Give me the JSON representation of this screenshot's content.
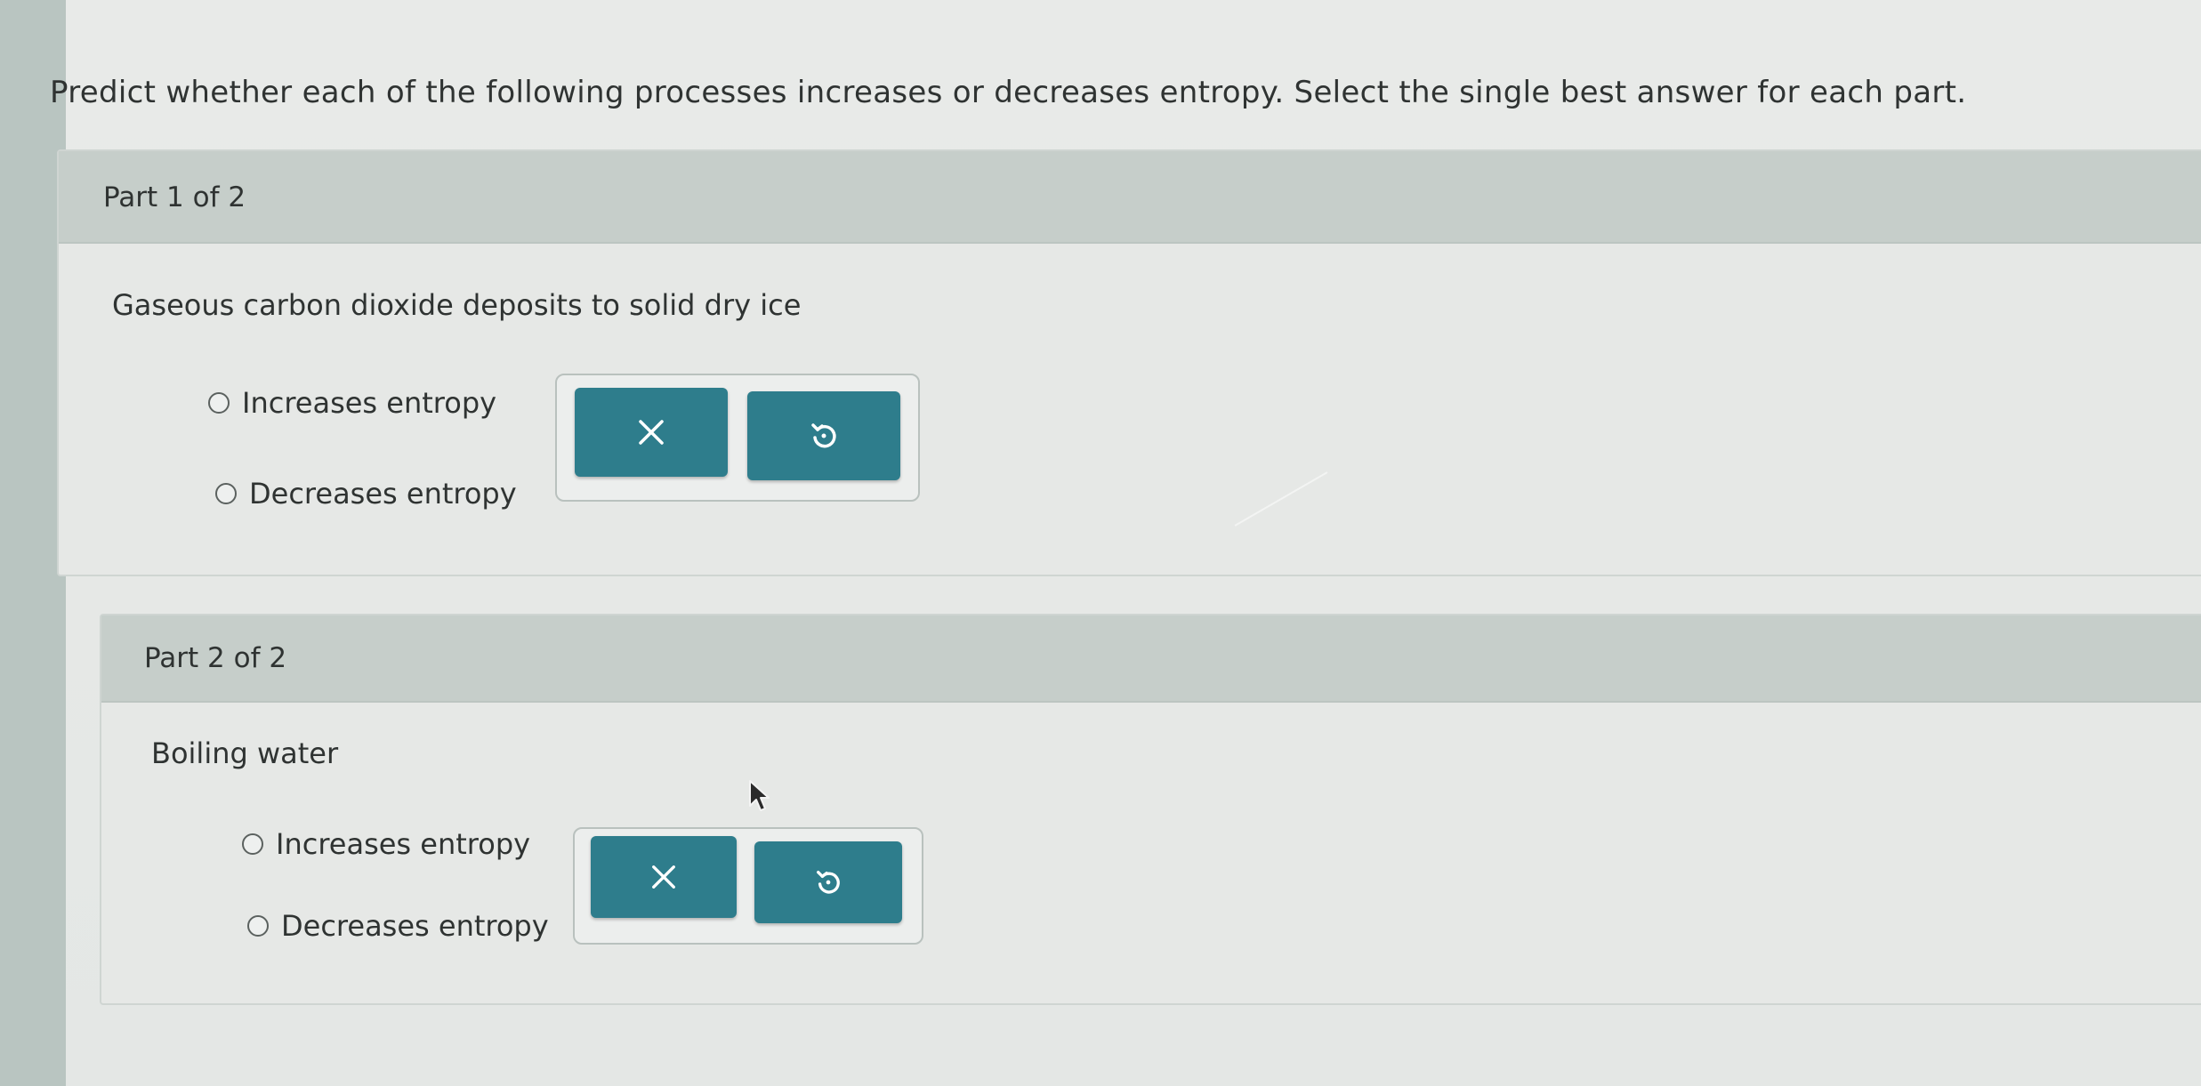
{
  "instructions": "Predict whether each of the following processes increases or decreases entropy. Select the single best answer for each part.",
  "parts": [
    {
      "label": "Part 1 of 2",
      "question": "Gaseous carbon dioxide deposits to solid dry ice",
      "options": [
        "Increases entropy",
        "Decreases entropy"
      ],
      "clear_icon": "x-icon",
      "undo_icon": "undo-icon"
    },
    {
      "label": "Part 2 of 2",
      "question": "Boiling water",
      "options": [
        "Increases entropy",
        "Decreases entropy"
      ],
      "clear_icon": "x-icon",
      "undo_icon": "undo-icon"
    }
  ],
  "colors": {
    "button": "#2e7d8c",
    "header": "#c6ceca",
    "background": "#e6e8e6"
  }
}
